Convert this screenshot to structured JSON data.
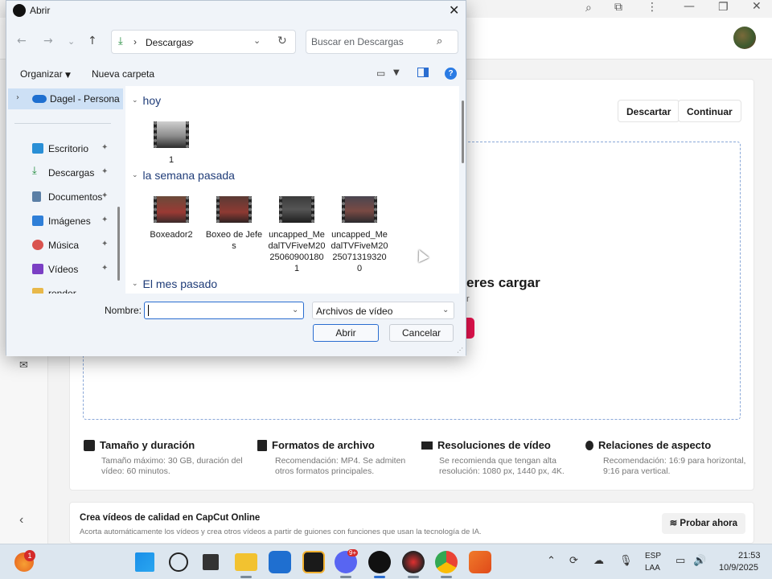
{
  "background_app": {
    "actions": {
      "discard_label": "Descartar",
      "continue_label": "Continuar"
    },
    "upload": {
      "title_fragment": "eres cargar",
      "subtitle_fragment": "r"
    },
    "features": [
      {
        "title": "Tamaño y duración",
        "desc": "Tamaño máximo: 30 GB, duración del vídeo: 60 minutos.",
        "icon": "film-icon"
      },
      {
        "title": "Formatos de archivo",
        "desc": "Recomendación: MP4. Se admiten otros formatos principales.",
        "icon": "file-icon"
      },
      {
        "title": "Resoluciones de vídeo",
        "desc": "Se recomienda que tengan alta resolución: 1080 px, 1440 px, 4K.",
        "icon": "resolution-icon"
      },
      {
        "title": "Relaciones de aspecto",
        "desc": "Recomendación: 16:9 para horizontal, 9:16 para vertical.",
        "icon": "bulb-icon"
      }
    ],
    "promo": {
      "title": "Crea vídeos de calidad en CapCut Online",
      "desc": "Acorta automáticamente los vídeos y crea otros vídeos a partir de guiones con funciones que usan la tecnología de IA.",
      "button": "Probar ahora"
    }
  },
  "dialog": {
    "title": "Abrir",
    "address": {
      "folder": "Descargas"
    },
    "search": {
      "placeholder": "Buscar en Descargas"
    },
    "commands": {
      "organize": "Organizar",
      "new_folder": "Nueva carpeta"
    },
    "nav": {
      "onedrive": "Dagel - Persona",
      "items": [
        {
          "label": "Escritorio",
          "color": "#2a8fd6"
        },
        {
          "label": "Descargas",
          "color": "#1f8a3a"
        },
        {
          "label": "Documentos",
          "color": "#5b7fa6"
        },
        {
          "label": "Imágenes",
          "color": "#2f7fd8"
        },
        {
          "label": "Música",
          "color": "#d9534f"
        },
        {
          "label": "Vídeos",
          "color": "#7b3fc4"
        },
        {
          "label": "render",
          "color": "#e8b84a"
        }
      ]
    },
    "groups": [
      {
        "header": "hoy",
        "files": [
          {
            "name": "1"
          }
        ]
      },
      {
        "header": "la semana pasada",
        "files": [
          {
            "name": "Boxeador2"
          },
          {
            "name": "Boxeo de Jefes"
          },
          {
            "name": "uncapped_MedalTVFiveM20250609001801"
          },
          {
            "name": "uncapped_MedalTVFiveM20250713193200"
          }
        ]
      },
      {
        "header": "El mes pasado",
        "files": []
      }
    ],
    "filename": {
      "label": "Nombre:",
      "value": ""
    },
    "filetype": {
      "value": "Archivos de vídeo"
    },
    "buttons": {
      "open": "Abrir",
      "cancel": "Cancelar"
    }
  },
  "taskbar": {
    "notification_count": "1",
    "discord_badge": "9+",
    "language": "ESP",
    "keyboard": "LAA",
    "time": "21:53",
    "date": "10/9/2025"
  }
}
